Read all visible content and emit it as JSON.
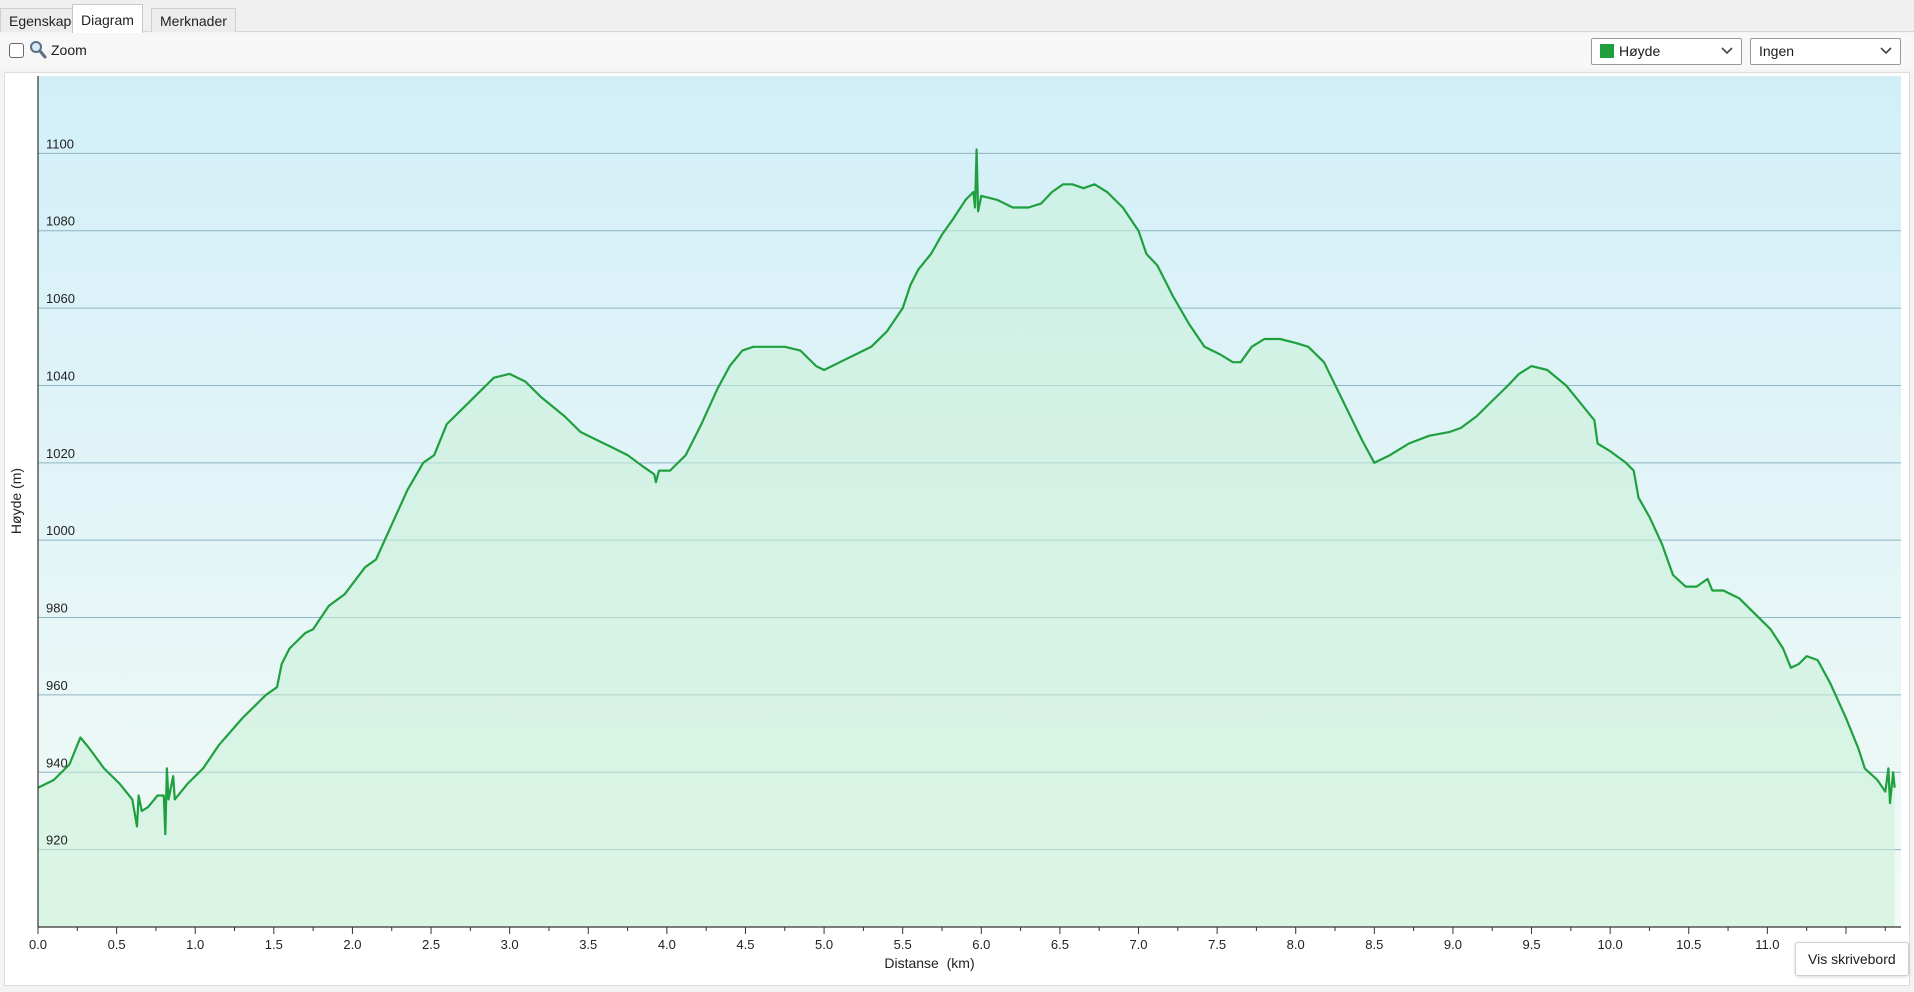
{
  "tabs": [
    {
      "label": "Egenskaper",
      "active": false
    },
    {
      "label": "Diagram",
      "active": true
    },
    {
      "label": "Merknader",
      "active": false
    }
  ],
  "toolbar": {
    "zoom_label": "Zoom",
    "zoom_checked": false,
    "series_select": {
      "value": "Høyde",
      "color": "#1e9e3c"
    },
    "secondary_select": {
      "value": "Ingen"
    }
  },
  "tooltip": "Vis skrivebord",
  "icons": {
    "zoom": "magnifier-icon",
    "dropdown": "chevron-down-icon"
  },
  "chart_data": {
    "type": "area",
    "xlabel": "Distanse  (km)",
    "ylabel": "Høyde (m)",
    "xlim": [
      0,
      11.85
    ],
    "ylim": [
      900,
      1120
    ],
    "x_ticks": [
      0.0,
      0.5,
      1.0,
      1.5,
      2.0,
      2.5,
      3.0,
      3.5,
      4.0,
      4.5,
      5.0,
      5.5,
      6.0,
      6.5,
      7.0,
      7.5,
      8.0,
      8.5,
      9.0,
      9.5,
      10.0,
      10.5,
      11.0
    ],
    "x_tick_labels": [
      "0.0",
      "0.5",
      "1.0",
      "1.5",
      "2.0",
      "2.5",
      "3.0",
      "3.5",
      "4.0",
      "4.5",
      "5.0",
      "5.5",
      "6.0",
      "6.5",
      "7.0",
      "7.5",
      "8.0",
      "8.5",
      "9.0",
      "9.5",
      "10.0",
      "10.5",
      "11.0"
    ],
    "y_ticks": [
      920,
      940,
      960,
      980,
      1000,
      1020,
      1040,
      1060,
      1080,
      1100
    ],
    "y_tick_labels": [
      "920",
      "940",
      "960",
      "980",
      "1000",
      "1020",
      "1040",
      "1060",
      "1080",
      "1100"
    ],
    "grid": "horizontal",
    "background": {
      "top": "#d2eff8",
      "bottom": "#f2faf6"
    },
    "line_color": "#1fa03f",
    "fill_color": "#c9f0d7",
    "series": [
      {
        "points": [
          [
            0.0,
            936
          ],
          [
            0.1,
            938
          ],
          [
            0.2,
            942
          ],
          [
            0.27,
            949
          ],
          [
            0.33,
            946
          ],
          [
            0.42,
            941
          ],
          [
            0.52,
            937
          ],
          [
            0.6,
            933
          ],
          [
            0.63,
            926
          ],
          [
            0.64,
            934
          ],
          [
            0.66,
            930
          ],
          [
            0.7,
            931
          ],
          [
            0.76,
            934
          ],
          [
            0.8,
            934
          ],
          [
            0.81,
            924
          ],
          [
            0.82,
            941
          ],
          [
            0.83,
            933
          ],
          [
            0.86,
            939
          ],
          [
            0.87,
            933
          ],
          [
            0.95,
            937
          ],
          [
            1.05,
            941
          ],
          [
            1.15,
            947
          ],
          [
            1.3,
            954
          ],
          [
            1.45,
            960
          ],
          [
            1.52,
            962
          ],
          [
            1.55,
            968
          ],
          [
            1.6,
            972
          ],
          [
            1.7,
            976
          ],
          [
            1.75,
            977
          ],
          [
            1.85,
            983
          ],
          [
            1.95,
            986
          ],
          [
            2.08,
            993
          ],
          [
            2.15,
            995
          ],
          [
            2.25,
            1004
          ],
          [
            2.35,
            1013
          ],
          [
            2.45,
            1020
          ],
          [
            2.52,
            1022
          ],
          [
            2.6,
            1030
          ],
          [
            2.7,
            1034
          ],
          [
            2.8,
            1038
          ],
          [
            2.9,
            1042
          ],
          [
            3.0,
            1043
          ],
          [
            3.1,
            1041
          ],
          [
            3.2,
            1037
          ],
          [
            3.35,
            1032
          ],
          [
            3.45,
            1028
          ],
          [
            3.55,
            1026
          ],
          [
            3.65,
            1024
          ],
          [
            3.75,
            1022
          ],
          [
            3.85,
            1019
          ],
          [
            3.92,
            1017
          ],
          [
            3.93,
            1015
          ],
          [
            3.95,
            1018
          ],
          [
            4.02,
            1018
          ],
          [
            4.12,
            1022
          ],
          [
            4.22,
            1030
          ],
          [
            4.32,
            1039
          ],
          [
            4.4,
            1045
          ],
          [
            4.48,
            1049
          ],
          [
            4.55,
            1050
          ],
          [
            4.65,
            1050
          ],
          [
            4.75,
            1050
          ],
          [
            4.85,
            1049
          ],
          [
            4.95,
            1045
          ],
          [
            5.0,
            1044
          ],
          [
            5.1,
            1046
          ],
          [
            5.2,
            1048
          ],
          [
            5.3,
            1050
          ],
          [
            5.4,
            1054
          ],
          [
            5.5,
            1060
          ],
          [
            5.55,
            1066
          ],
          [
            5.6,
            1070
          ],
          [
            5.68,
            1074
          ],
          [
            5.75,
            1079
          ],
          [
            5.82,
            1083
          ],
          [
            5.9,
            1088
          ],
          [
            5.95,
            1090
          ],
          [
            5.96,
            1086
          ],
          [
            5.97,
            1101
          ],
          [
            5.98,
            1085
          ],
          [
            6.0,
            1089
          ],
          [
            6.1,
            1088
          ],
          [
            6.2,
            1086
          ],
          [
            6.3,
            1086
          ],
          [
            6.38,
            1087
          ],
          [
            6.45,
            1090
          ],
          [
            6.52,
            1092
          ],
          [
            6.58,
            1092
          ],
          [
            6.65,
            1091
          ],
          [
            6.72,
            1092
          ],
          [
            6.8,
            1090
          ],
          [
            6.9,
            1086
          ],
          [
            7.0,
            1080
          ],
          [
            7.05,
            1074
          ],
          [
            7.12,
            1071
          ],
          [
            7.22,
            1063
          ],
          [
            7.32,
            1056
          ],
          [
            7.42,
            1050
          ],
          [
            7.52,
            1048
          ],
          [
            7.6,
            1046
          ],
          [
            7.65,
            1046
          ],
          [
            7.72,
            1050
          ],
          [
            7.8,
            1052
          ],
          [
            7.9,
            1052
          ],
          [
            8.0,
            1051
          ],
          [
            8.08,
            1050
          ],
          [
            8.18,
            1046
          ],
          [
            8.3,
            1036
          ],
          [
            8.42,
            1026
          ],
          [
            8.5,
            1020
          ],
          [
            8.6,
            1022
          ],
          [
            8.72,
            1025
          ],
          [
            8.85,
            1027
          ],
          [
            8.98,
            1028
          ],
          [
            9.05,
            1029
          ],
          [
            9.15,
            1032
          ],
          [
            9.25,
            1036
          ],
          [
            9.35,
            1040
          ],
          [
            9.42,
            1043
          ],
          [
            9.5,
            1045
          ],
          [
            9.6,
            1044
          ],
          [
            9.72,
            1040
          ],
          [
            9.82,
            1035
          ],
          [
            9.9,
            1031
          ],
          [
            9.92,
            1025
          ],
          [
            10.0,
            1023
          ],
          [
            10.1,
            1020
          ],
          [
            10.15,
            1018
          ],
          [
            10.18,
            1011
          ],
          [
            10.25,
            1006
          ],
          [
            10.33,
            999
          ],
          [
            10.4,
            991
          ],
          [
            10.48,
            988
          ],
          [
            10.55,
            988
          ],
          [
            10.62,
            990
          ],
          [
            10.65,
            987
          ],
          [
            10.72,
            987
          ],
          [
            10.82,
            985
          ],
          [
            10.92,
            981
          ],
          [
            11.02,
            977
          ],
          [
            11.1,
            972
          ],
          [
            11.15,
            967
          ],
          [
            11.2,
            968
          ],
          [
            11.25,
            970
          ],
          [
            11.32,
            969
          ],
          [
            11.4,
            963
          ],
          [
            11.5,
            954
          ],
          [
            11.58,
            946
          ],
          [
            11.62,
            941
          ],
          [
            11.7,
            938
          ],
          [
            11.75,
            935
          ],
          [
            11.77,
            941
          ],
          [
            11.78,
            932
          ],
          [
            11.8,
            940
          ],
          [
            11.81,
            936
          ]
        ]
      }
    ]
  }
}
